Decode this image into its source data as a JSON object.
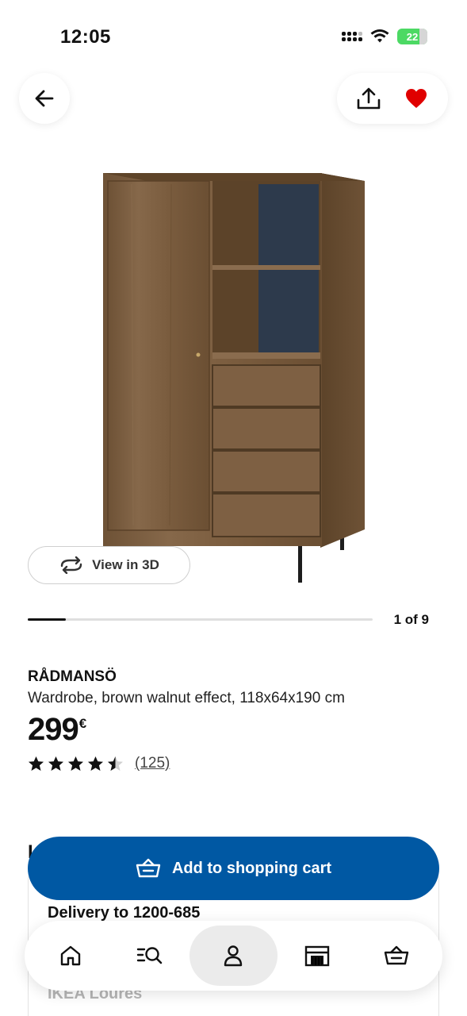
{
  "status_bar": {
    "time": "12:05",
    "battery": "22"
  },
  "product": {
    "name": "RÅDMANSÖ",
    "description": "Wardrobe, brown walnut effect, 118x64x190 cm",
    "price": "299",
    "currency": "€",
    "rating_value": 4.5,
    "rating_max": 5,
    "review_count": "(125)"
  },
  "gallery": {
    "view_3d_label": "View in 3D",
    "counter": "1 of 9",
    "current": 1,
    "total": 9
  },
  "partial_heading": "I",
  "cart": {
    "label": "Add to shopping cart"
  },
  "delivery": {
    "title": "Delivery to 1200-685",
    "store": "IKEA Loures"
  },
  "nav": {
    "items": [
      "home-icon",
      "search-icon",
      "profile-icon",
      "store-icon",
      "cart-icon"
    ],
    "active": "profile-icon"
  },
  "colors": {
    "ikea_blue": "#0058a3",
    "favorite_red": "#e00000",
    "battery_green": "#4cd964"
  }
}
